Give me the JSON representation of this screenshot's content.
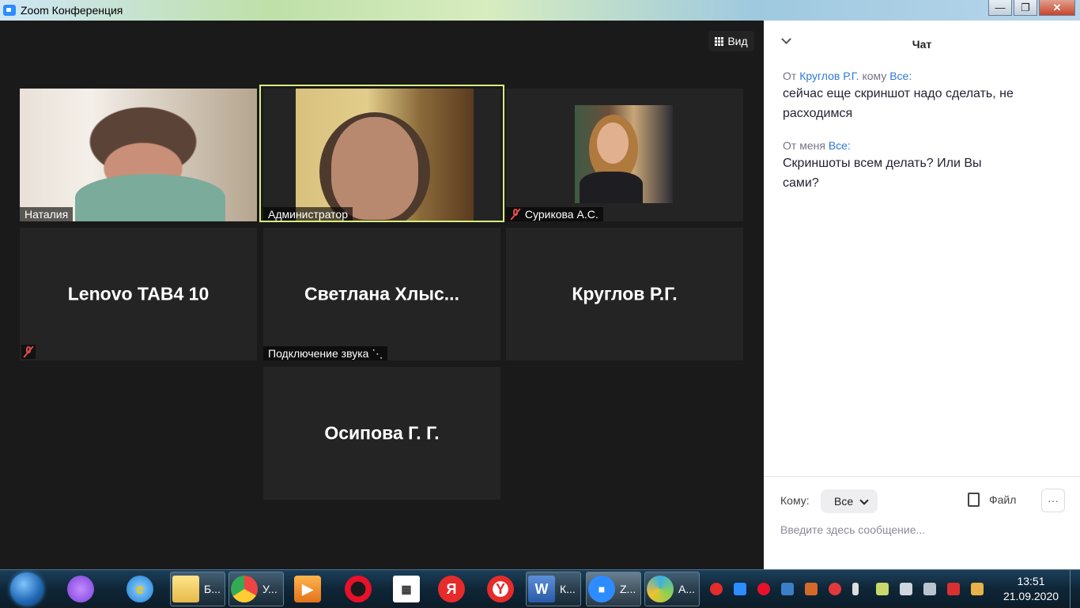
{
  "window": {
    "title": "Zoom Конференция",
    "buttons": {
      "minimize": "—",
      "maximize": "❐",
      "close": "✕"
    }
  },
  "toolbar": {
    "view_label": "Вид"
  },
  "participants": [
    {
      "name": "Наталия",
      "video": true,
      "muted": false
    },
    {
      "name": "Администратор",
      "video": true,
      "muted": false,
      "active_speaker": true
    },
    {
      "name": "Сурикова А.С.",
      "video": true,
      "muted": true
    },
    {
      "name": "Lenovo TAB4 10",
      "video": false,
      "muted": true
    },
    {
      "name": "Светлана  Хлыс...",
      "video": false,
      "status": "Подключение звука"
    },
    {
      "name": "Круглов Р.Г.",
      "video": false
    },
    {
      "name": "Осипова Г. Г.",
      "video": false
    }
  ],
  "chat": {
    "title": "Чат",
    "messages": [
      {
        "prefix": "От",
        "from": "Круглов Р.Г.",
        "middle": "кому",
        "to": "Все:",
        "text": "сейчас еще скриншот надо сделать, не расходимся"
      },
      {
        "prefix": "От меня",
        "to": "Все:",
        "text": "Скриншоты всем делать? Или Вы сами?"
      }
    ],
    "to_label": "Кому:",
    "to_value": "Все",
    "file_label": "Файл",
    "more_label": "···",
    "input_placeholder": "Введите здесь сообщение..."
  },
  "taskbar": {
    "items": [
      {
        "label": "Б...",
        "icon": "file-explorer-icon"
      },
      {
        "label": "У...",
        "icon": "chrome-icon"
      },
      {
        "label": "К...",
        "icon": "word-icon"
      },
      {
        "label": "Z...",
        "icon": "zoom-icon"
      },
      {
        "label": "А...",
        "icon": "app-icon"
      }
    ],
    "pinned": [
      "alice-icon",
      "internet-explorer-icon",
      "media-player-icon",
      "opera-icon",
      "calendar-icon",
      "yandex-icon",
      "yandex-browser-icon"
    ],
    "clock": {
      "time": "13:51",
      "date": "21.09.2020"
    }
  },
  "colors": {
    "active_speaker_border": "#d8ef7e",
    "link": "#2d7ad6",
    "muted": "#e34c4c"
  }
}
